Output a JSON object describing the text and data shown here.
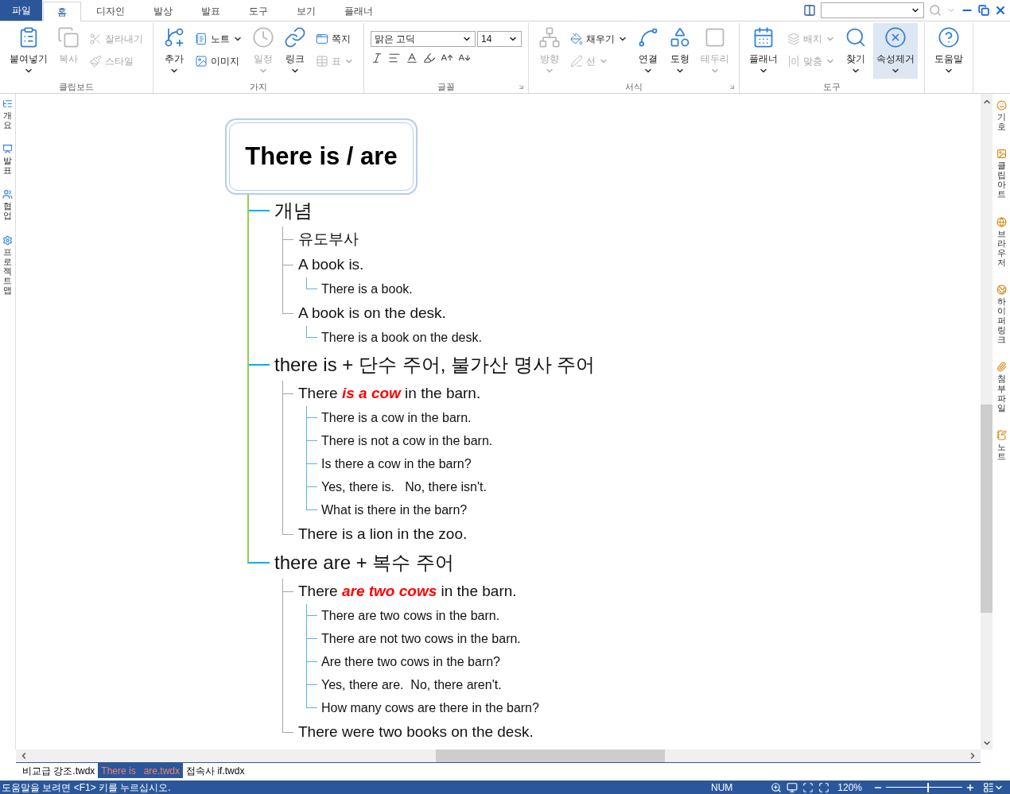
{
  "tabs": [
    {
      "label": "파일",
      "kind": "file",
      "selected": false
    },
    {
      "label": "홈",
      "kind": "tab",
      "selected": true
    },
    {
      "label": "디자인",
      "kind": "tab",
      "selected": false
    },
    {
      "label": "발상",
      "kind": "tab",
      "selected": false
    },
    {
      "label": "발표",
      "kind": "tab",
      "selected": false
    },
    {
      "label": "도구",
      "kind": "tab",
      "selected": false
    },
    {
      "label": "보기",
      "kind": "tab",
      "selected": false
    },
    {
      "label": "플래너",
      "kind": "tab",
      "selected": false
    }
  ],
  "ribbon": {
    "groups": [
      {
        "label": "클립보드",
        "kind": "buttons",
        "launcher": false,
        "items": [
          {
            "label": "붙여넣기",
            "kind": "large",
            "disabled": false,
            "dropdown": true,
            "highlighted": false
          },
          {
            "label": "복사",
            "kind": "large",
            "disabled": true,
            "dropdown": false,
            "highlighted": false
          },
          {
            "label": "잘라내기",
            "kind": "small",
            "disabled": true,
            "dropdown": false,
            "highlighted": false
          },
          {
            "label": "스타일",
            "kind": "small",
            "disabled": true,
            "dropdown": false,
            "highlighted": false
          }
        ]
      },
      {
        "label": "가지",
        "kind": "buttons",
        "launcher": false,
        "items": [
          {
            "label": "추가",
            "kind": "large",
            "disabled": false,
            "dropdown": true,
            "highlighted": false
          },
          {
            "label": "노트",
            "kind": "small",
            "disabled": false,
            "dropdown": true,
            "highlighted": false
          },
          {
            "label": "이미지",
            "kind": "small",
            "disabled": false,
            "dropdown": false,
            "highlighted": false
          },
          {
            "label": "일정",
            "kind": "large",
            "disabled": true,
            "dropdown": true,
            "highlighted": false
          },
          {
            "label": "링크",
            "kind": "large",
            "disabled": false,
            "dropdown": true,
            "highlighted": false
          },
          {
            "label": "쪽지",
            "kind": "small",
            "disabled": false,
            "dropdown": false,
            "highlighted": false
          },
          {
            "label": "표",
            "kind": "small",
            "disabled": true,
            "dropdown": true,
            "highlighted": false
          }
        ]
      },
      {
        "label": "글꼴",
        "kind": "font",
        "launcher": true,
        "font": "맑은 고딕",
        "size": "14"
      },
      {
        "label": "서식",
        "kind": "buttons",
        "launcher": true,
        "items": [
          {
            "label": "방향",
            "kind": "large",
            "disabled": true,
            "dropdown": true,
            "highlighted": false
          },
          {
            "label": "채우기",
            "kind": "small",
            "disabled": false,
            "dropdown": true,
            "highlighted": false
          },
          {
            "label": "선",
            "kind": "small",
            "disabled": true,
            "dropdown": true,
            "highlighted": false
          },
          {
            "label": "연결",
            "kind": "large",
            "disabled": false,
            "dropdown": true,
            "highlighted": false
          },
          {
            "label": "도형",
            "kind": "large",
            "disabled": false,
            "dropdown": true,
            "highlighted": false
          },
          {
            "label": "테두리",
            "kind": "large",
            "disabled": true,
            "dropdown": true,
            "highlighted": false
          }
        ]
      },
      {
        "label": "도구",
        "kind": "buttons",
        "launcher": false,
        "items": [
          {
            "label": "플래너",
            "kind": "large",
            "disabled": false,
            "dropdown": true,
            "highlighted": false
          },
          {
            "label": "배치",
            "kind": "small",
            "disabled": true,
            "dropdown": true,
            "highlighted": false
          },
          {
            "label": "맞춤",
            "kind": "small",
            "disabled": true,
            "dropdown": true,
            "highlighted": false
          },
          {
            "label": "찾기",
            "kind": "large",
            "disabled": false,
            "dropdown": true,
            "highlighted": false
          },
          {
            "label": "속성제거",
            "kind": "large",
            "disabled": false,
            "dropdown": true,
            "highlighted": true
          }
        ]
      },
      {
        "kind": "buttons",
        "launcher": false,
        "items": [
          {
            "label": "도움말",
            "kind": "large",
            "disabled": false,
            "dropdown": true,
            "highlighted": false
          }
        ]
      }
    ]
  },
  "left_panel": [
    "개요",
    "발표",
    "협업",
    "프로젝트맵"
  ],
  "right_panel": [
    "기호",
    "클립아트",
    "브라우저",
    "하이퍼링크",
    "첨부파일",
    "노트"
  ],
  "mindmap": {
    "root": "There is / are",
    "branches": [
      {
        "text": "개념",
        "children": [
          {
            "text": "유도부사"
          },
          {
            "text": "A book is.",
            "children": [
              {
                "text": "There is a book."
              }
            ]
          },
          {
            "text": "A book is on the desk.",
            "children": [
              {
                "text": "There is a book on the desk."
              }
            ]
          }
        ]
      },
      {
        "text": "there is + 단수 주어, 불가산 명사 주어",
        "children": [
          {
            "parts": [
              {
                "text": "There ",
                "emphasis": false
              },
              {
                "text": "is a cow",
                "emphasis": true
              },
              {
                "text": " in the barn.",
                "emphasis": false
              }
            ],
            "children": [
              {
                "text": "There is a cow in the barn."
              },
              {
                "text": "There is not a cow in the barn."
              },
              {
                "text": "Is there a cow in the barn?"
              },
              {
                "text": "Yes, there is.   No, there isn't."
              },
              {
                "text": "What is there in the barn?"
              }
            ]
          },
          {
            "text": "There is a lion in the zoo."
          }
        ]
      },
      {
        "text": "there are + 복수 주어",
        "children": [
          {
            "parts": [
              {
                "text": "There ",
                "emphasis": false
              },
              {
                "text": "are two cows",
                "emphasis": true
              },
              {
                "text": " in the barn.",
                "emphasis": false
              }
            ],
            "children": [
              {
                "text": "There are two cows in the barn."
              },
              {
                "text": "There are not two cows in the barn."
              },
              {
                "text": "Are there two cows in the barn?"
              },
              {
                "text": "Yes, there are.  No, there aren't."
              },
              {
                "text": "How many cows are there in the barn?"
              }
            ]
          },
          {
            "text": "There were two books on the desk."
          }
        ]
      }
    ]
  },
  "documents": [
    {
      "label": "비교급 강조.twdx",
      "selected": false
    },
    {
      "label": "There is   are.twdx",
      "selected": true
    },
    {
      "label": "접속사 if.twdx",
      "selected": false
    }
  ],
  "status_bar": {
    "message": "도움말을 보려면 <F1> 키를 누르십시오.",
    "num": "NUM",
    "zoom": "120%",
    "zoom_slider": {
      "level": 0.54
    }
  }
}
